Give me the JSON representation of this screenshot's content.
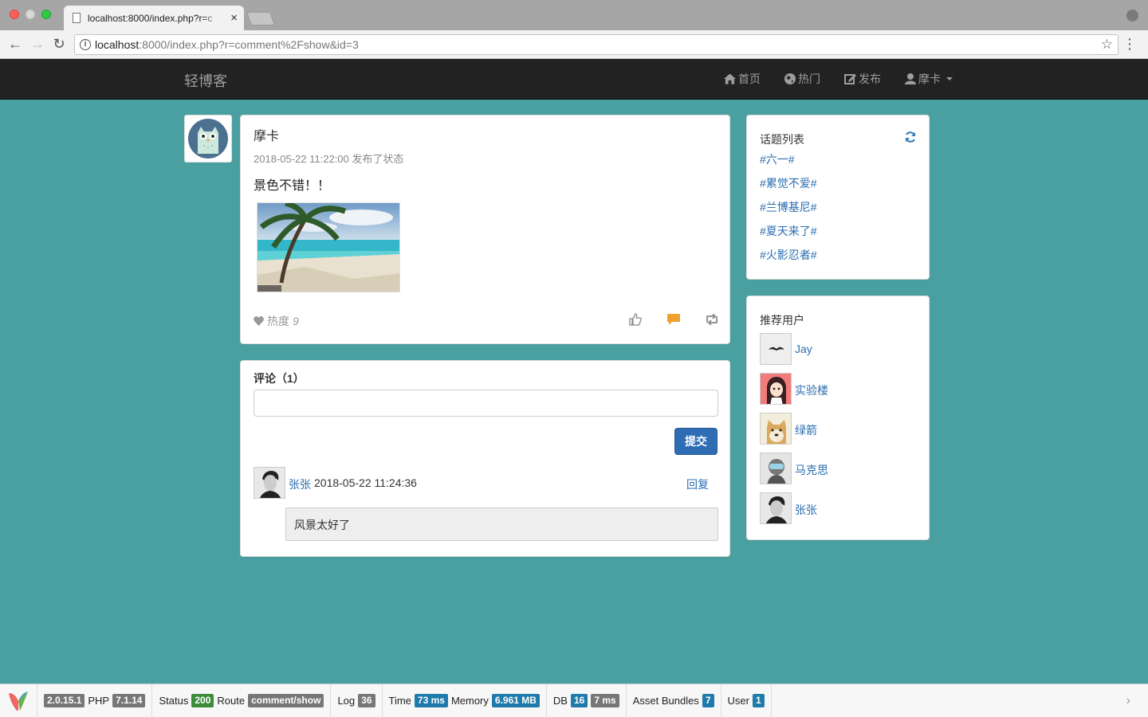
{
  "browser": {
    "tab_title": "localhost:8000/index.php?r=c",
    "url_host": "localhost",
    "url_rest": ":8000/index.php?r=comment%2Fshow&id=3"
  },
  "navbar": {
    "brand": "轻博客",
    "links": [
      {
        "label": "首页",
        "icon": "home-icon"
      },
      {
        "label": "热门",
        "icon": "globe-icon"
      },
      {
        "label": "发布",
        "icon": "edit-icon"
      },
      {
        "label": "摩卡",
        "icon": "user-icon"
      }
    ]
  },
  "post": {
    "author": "摩卡",
    "meta": "2018-05-22 11:22:00 发布了状态",
    "content": "景色不错！！",
    "hot_label": "热度",
    "hot_count": "9"
  },
  "comments": {
    "title": "评论（1）",
    "input_value": "",
    "submit_label": "提交",
    "items": [
      {
        "user": "张张",
        "time": "2018-05-22 11:24:36",
        "reply_label": "回复",
        "body": "风景太好了"
      }
    ]
  },
  "topics": {
    "title": "话题列表",
    "items": [
      "#六一#",
      "#累觉不爱#",
      "#兰博基尼#",
      "#夏天来了#",
      "#火影忍者#"
    ]
  },
  "users": {
    "title": "推荐用户",
    "items": [
      "Jay",
      "实验楼",
      "绿箭",
      "马克思",
      "张张"
    ]
  },
  "debug": {
    "yii_version": "2.0.15.1",
    "php_label": "PHP",
    "php_version": "7.1.14",
    "status_label": "Status",
    "status_code": "200",
    "route_label": "Route",
    "route": "comment/show",
    "log_label": "Log",
    "log_count": "36",
    "time_label": "Time",
    "time_value": "73 ms",
    "memory_label": "Memory",
    "memory_value": "6.961 MB",
    "db_label": "DB",
    "db_count": "16",
    "db_time": "7 ms",
    "assets_label": "Asset Bundles",
    "assets_count": "7",
    "user_label": "User",
    "user_value": "1"
  },
  "colors": {
    "page_bg": "#4aa0a0",
    "navbar_bg": "#222222",
    "link": "#2a6db0",
    "primary_button": "#2e6db4",
    "comment_icon": "#f0a030"
  }
}
